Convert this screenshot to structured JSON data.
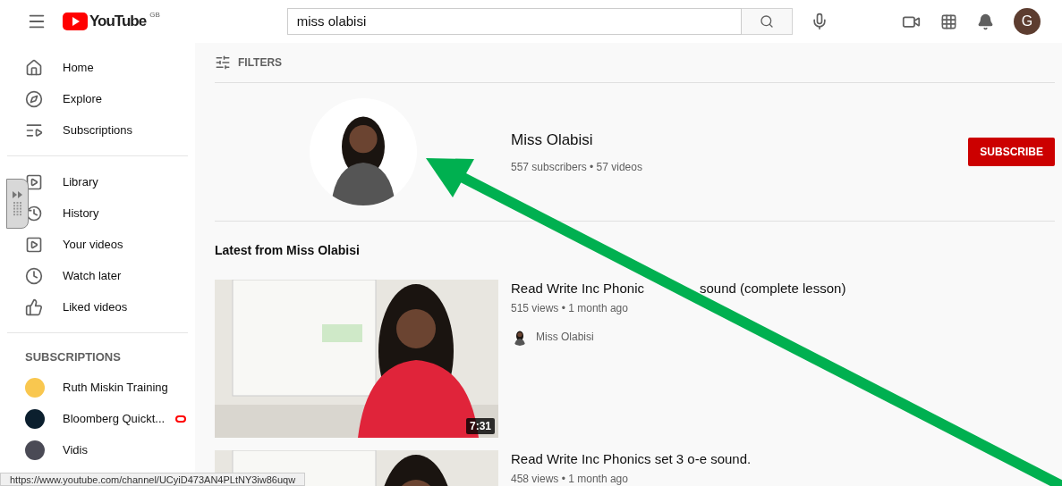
{
  "header": {
    "logo_text": "YouTube",
    "region": "GB",
    "search": {
      "value": "miss olabisi"
    },
    "avatar_letter": "G"
  },
  "sidebar": {
    "main": [
      {
        "label": "Home"
      },
      {
        "label": "Explore"
      },
      {
        "label": "Subscriptions"
      }
    ],
    "library": [
      {
        "label": "Library"
      },
      {
        "label": "History"
      },
      {
        "label": "Your videos"
      },
      {
        "label": "Watch later"
      },
      {
        "label": "Liked videos"
      }
    ],
    "subscriptions_heading": "SUBSCRIPTIONS",
    "subscriptions": [
      {
        "label": "Ruth Miskin Training",
        "color": "#f9c74f",
        "live": false
      },
      {
        "label": "Bloomberg Quickt...",
        "color": "#0b1f2e",
        "live": true
      },
      {
        "label": "Vidis",
        "color": "#4a4a55",
        "live": false
      }
    ]
  },
  "filters": "FILTERS",
  "channel": {
    "name": "Miss Olabisi",
    "stats": "557 subscribers • 57 videos",
    "subscribe": "SUBSCRIBE"
  },
  "latest_heading": "Latest from Miss Olabisi",
  "videos": [
    {
      "title_parts": [
        "Read Write Inc Phonic",
        "sound (complete lesson)"
      ],
      "meta": "515 views • 1 month ago",
      "channel": "Miss Olabisi",
      "duration": "7:31"
    },
    {
      "title_parts": [
        "Read Write Inc Phonics set 3 o-e sound."
      ],
      "meta": "458 views • 1 month ago"
    }
  ],
  "status_url": "https://www.youtube.com/channel/UCyiD473AN4PLtNY3iw86uqw"
}
